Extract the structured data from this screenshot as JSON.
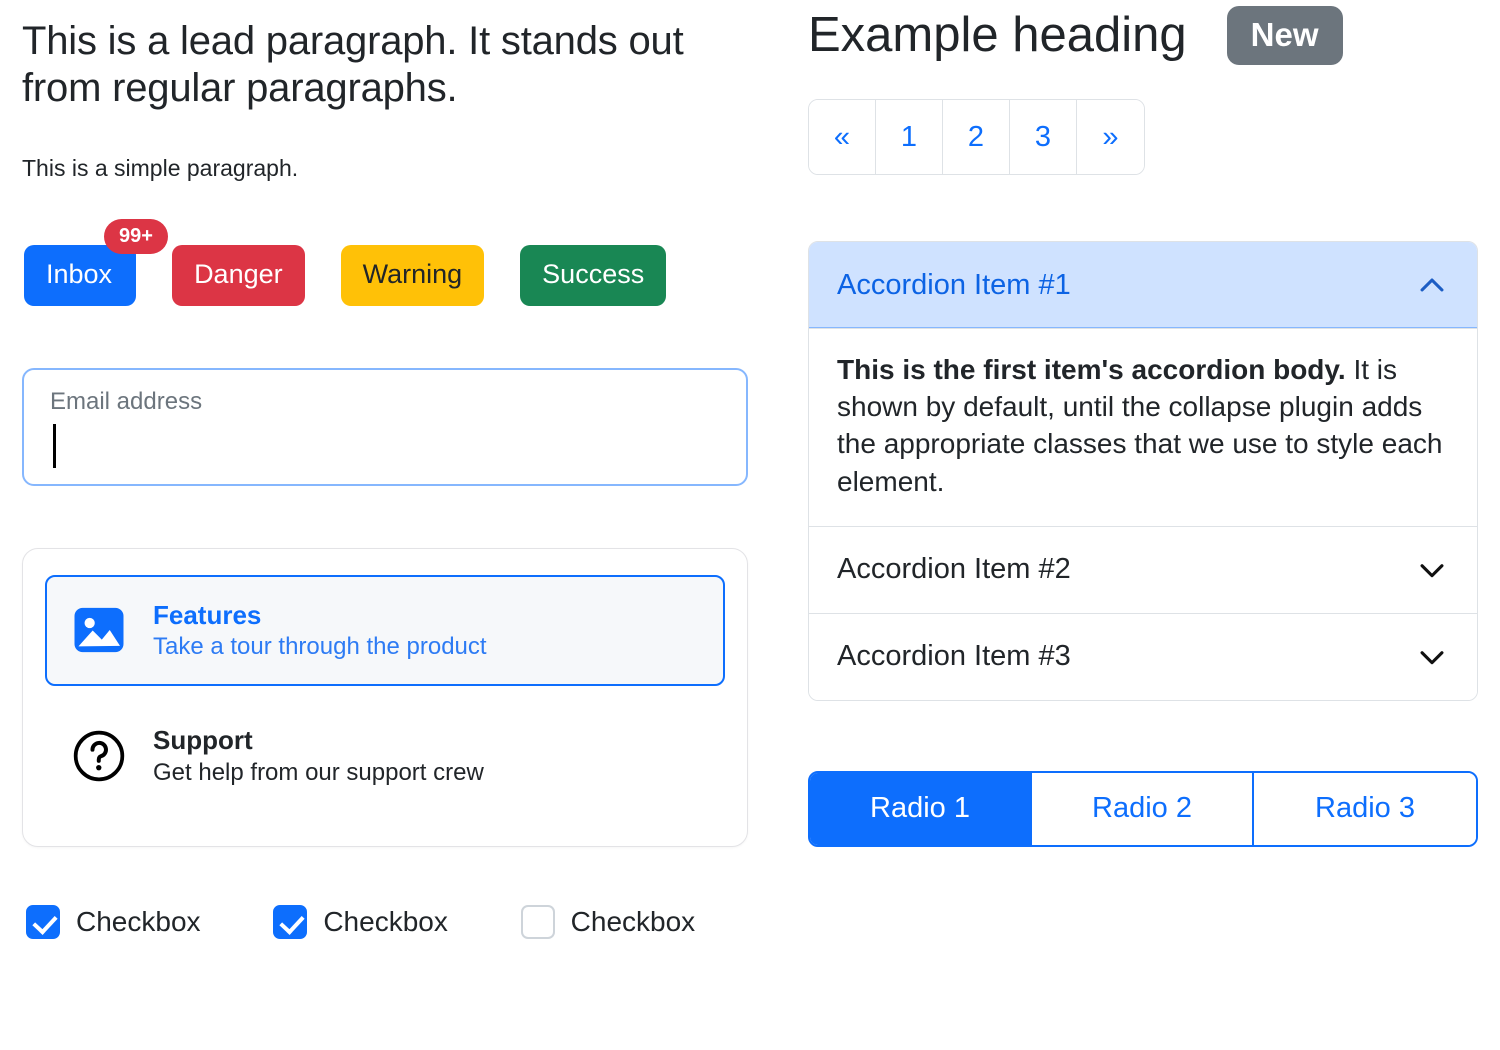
{
  "left": {
    "lead_paragraph": "This is a lead paragraph. It stands out from regular paragraphs.",
    "simple_paragraph": "This is a simple paragraph.",
    "buttons": [
      {
        "label": "Inbox",
        "variant": "primary",
        "badge": "99+"
      },
      {
        "label": "Danger",
        "variant": "danger"
      },
      {
        "label": "Warning",
        "variant": "warning"
      },
      {
        "label": "Success",
        "variant": "success"
      }
    ],
    "email_input": {
      "label": "Email address",
      "placeholder": "Email address",
      "value": ""
    },
    "list_group": [
      {
        "title": "Features",
        "subtitle": "Take a tour through the product",
        "icon": "image-icon",
        "active": true
      },
      {
        "title": "Support",
        "subtitle": "Get help from our support crew",
        "icon": "question-circle-icon",
        "active": false
      }
    ],
    "checkboxes": [
      {
        "label": "Checkbox",
        "checked": true
      },
      {
        "label": "Checkbox",
        "checked": true
      },
      {
        "label": "Checkbox",
        "checked": false
      }
    ]
  },
  "right": {
    "heading": "Example heading",
    "heading_badge": "New",
    "pagination": [
      {
        "label": "«",
        "name": "previous"
      },
      {
        "label": "1",
        "name": "page-1"
      },
      {
        "label": "2",
        "name": "page-2"
      },
      {
        "label": "3",
        "name": "page-3"
      },
      {
        "label": "»",
        "name": "next"
      }
    ],
    "accordion": [
      {
        "header": "Accordion Item #1",
        "open": true,
        "body_bold": "This is the first item's accordion body.",
        "body_text": " It is shown by default, until the collapse plugin adds the appropriate classes that we use to style each element."
      },
      {
        "header": "Accordion Item #2",
        "open": false
      },
      {
        "header": "Accordion Item #3",
        "open": false
      }
    ],
    "radio_group": [
      {
        "label": "Radio 1",
        "active": true
      },
      {
        "label": "Radio 2",
        "active": false
      },
      {
        "label": "Radio 3",
        "active": false
      }
    ]
  },
  "colors": {
    "primary": "#0d6efd",
    "danger": "#dc3545",
    "warning": "#ffc107",
    "success": "#198754",
    "secondary": "#6c757d",
    "accordion_open_bg": "#cfe2ff",
    "accordion_open_text": "#0c63e4",
    "input_border_focus": "#86b7fe"
  }
}
